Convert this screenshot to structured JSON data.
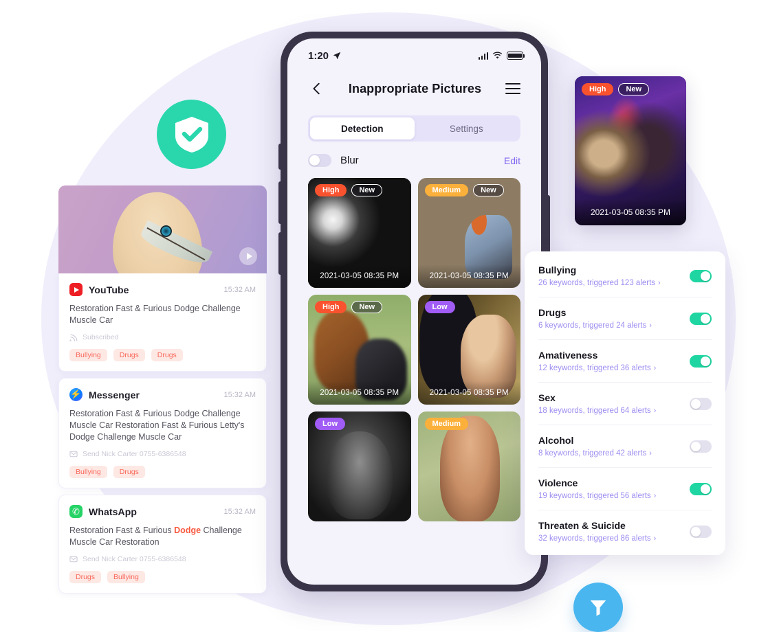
{
  "logo": {
    "icon": "shield-check-icon",
    "color": "#2ad7ad"
  },
  "notifications": [
    {
      "app": "YouTube",
      "icon": "youtube-icon",
      "time": "15:32 AM",
      "body": "Restoration Fast & Furious Dodge Challenge Muscle Car",
      "meta": "Subscribed",
      "meta_icon": "rss-icon",
      "tags": [
        "Bullying",
        "Drugs",
        "Drugs"
      ]
    },
    {
      "app": "Messenger",
      "icon": "messenger-icon",
      "time": "15:32 AM",
      "body": "Restoration Fast & Furious Dodge Challenge Muscle Car Restoration Fast & Furious Letty's Dodge Challenge Muscle Car",
      "meta": "Send  Nick Carter 0755-6386548",
      "meta_icon": "message-send-icon",
      "tags": [
        "Bullying",
        "Drugs"
      ]
    },
    {
      "app": "WhatsApp",
      "icon": "whatsapp-icon",
      "time": "15:32 AM",
      "body_pre": "Restoration Fast & Furious ",
      "body_highlight": "Dodge",
      "body_post": " Challenge Muscle Car Restoration",
      "meta": "Send  Nick Carter 0755-6386548",
      "meta_icon": "message-send-icon",
      "tags": [
        "Drugs",
        "Bullying"
      ]
    }
  ],
  "phone": {
    "statusbar": {
      "time": "1:20",
      "location_icon": "location-arrow-icon",
      "signal_icon": "cellular-icon",
      "wifi_icon": "wifi-icon",
      "battery_icon": "battery-full-icon"
    },
    "nav": {
      "back_icon": "chevron-left-icon",
      "title": "Inappropriate Pictures",
      "menu_icon": "hamburger-menu-icon"
    },
    "tabs": [
      {
        "label": "Detection",
        "active": true
      },
      {
        "label": "Settings",
        "active": false
      }
    ],
    "blur": {
      "label": "Blur",
      "enabled": false,
      "edit_label": "Edit"
    },
    "photos": [
      {
        "level": "High",
        "is_new": true,
        "timestamp": "2021-03-05 08:35 PM",
        "art": "art1"
      },
      {
        "level": "Medium",
        "is_new": true,
        "timestamp": "2021-03-05 08:35 PM",
        "art": "art2"
      },
      {
        "level": "High",
        "is_new": true,
        "timestamp": "2021-03-05 08:35 PM",
        "art": "art3"
      },
      {
        "level": "Low",
        "is_new": false,
        "timestamp": "2021-03-05 08:35 PM",
        "art": "art4"
      },
      {
        "level": "Low",
        "is_new": false,
        "timestamp": "",
        "art": "art5"
      },
      {
        "level": "Medium",
        "is_new": false,
        "timestamp": "",
        "art": "art6"
      }
    ],
    "new_badge_label": "New"
  },
  "float_photo": {
    "level": "High",
    "new_label": "New",
    "timestamp": "2021-03-05 08:35 PM"
  },
  "settings": {
    "rows": [
      {
        "title": "Bullying",
        "sub": "26 keywords, triggered 123 alerts",
        "on": true
      },
      {
        "title": "Drugs",
        "sub": "6 keywords, triggered 24 alerts",
        "on": true
      },
      {
        "title": "Amativeness",
        "sub": "12 keywords, triggered 36 alerts",
        "on": true
      },
      {
        "title": "Sex",
        "sub": "18 keywords, triggered 64 alerts",
        "on": false
      },
      {
        "title": "Alcohol",
        "sub": "8 keywords, triggered 42 alerts",
        "on": false
      },
      {
        "title": "Violence",
        "sub": "19 keywords, triggered 56 alerts",
        "on": true
      },
      {
        "title": "Threaten & Suicide",
        "sub": "32 keywords, triggered 86 alerts",
        "on": false
      }
    ],
    "chevron": "›"
  },
  "filter_badge": {
    "icon": "funnel-filter-icon",
    "color": "#49b6ef"
  },
  "colors": {
    "background_circle": "#f0eefb",
    "accent_purple": "#8266f0",
    "accent_teal": "#20d5a5",
    "level_high": "#f9522e",
    "level_medium": "#fbb03b",
    "level_low": "#a05cf5",
    "tag_text": "#f9685a"
  }
}
